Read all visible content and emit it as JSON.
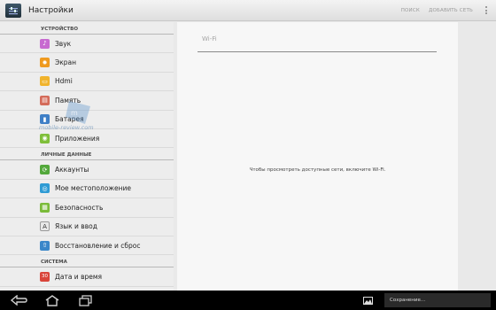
{
  "app": {
    "title": "Настройки"
  },
  "actions": {
    "search": "ПОИСК",
    "add_network": "ДОБАВИТЬ СЕТЬ"
  },
  "sections": {
    "device": "УСТРОЙСТВО",
    "personal": "ЛИЧНЫЕ ДАННЫЕ",
    "system": "СИСТЕМА"
  },
  "device_items": [
    {
      "label": "Звук",
      "icon": "speaker-icon",
      "color": "#c76ad0"
    },
    {
      "label": "Экран",
      "icon": "display-icon",
      "color": "#ef9a1f"
    },
    {
      "label": "Hdmi",
      "icon": "hdmi-icon",
      "color": "#f0b32c"
    },
    {
      "label": "Память",
      "icon": "storage-icon",
      "color": "#d46b5a"
    },
    {
      "label": "Батарея",
      "icon": "battery-icon",
      "color": "#3f7fc6"
    },
    {
      "label": "Приложения",
      "icon": "android-icon",
      "color": "#7fbf3a"
    }
  ],
  "personal_items": [
    {
      "label": "Аккаунты",
      "icon": "sync-icon",
      "color": "#53a83b"
    },
    {
      "label": "Мое местоположение",
      "icon": "location-icon",
      "color": "#2f9bd4"
    },
    {
      "label": "Безопасность",
      "icon": "grid-icon",
      "color": "#7abb39"
    },
    {
      "label": "Язык и ввод",
      "icon": "keyboard-icon",
      "color": "#e8e8e8"
    },
    {
      "label": "Восстановление и сброс",
      "icon": "backup-icon",
      "color": "#3a86c9"
    }
  ],
  "system_items": [
    {
      "label": "Дата и время",
      "icon": "calendar-icon",
      "color": "#d9453a"
    }
  ],
  "wifi": {
    "title": "Wi-Fi",
    "message": "Чтобы просмотреть доступные сети, включите Wi-Fi."
  },
  "watermark": {
    "text": "mobile-review.com"
  },
  "status": {
    "text": "Сохранение..."
  }
}
